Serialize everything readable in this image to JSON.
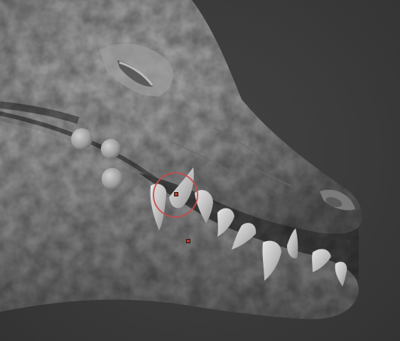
{
  "viewport": {
    "background": "#3a3a3a",
    "model_color": "#8a8a8a",
    "brush_color": "#c84a4a",
    "marker_color": "#c0392b"
  },
  "scene": {
    "model": "crocodile-head-sculpt",
    "visible_teeth": 9,
    "eye_state": "closed",
    "brush_cursor": "circle",
    "pivot_markers": 2
  }
}
